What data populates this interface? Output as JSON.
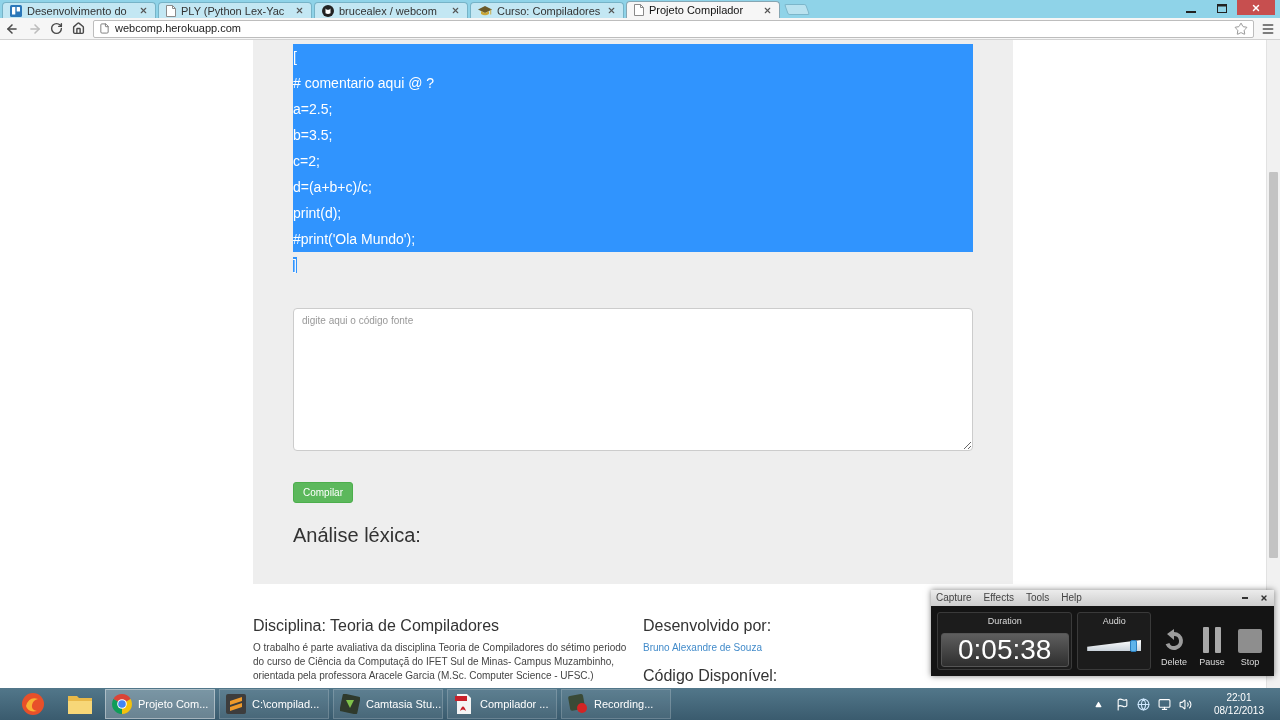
{
  "browser": {
    "tabs": [
      {
        "kind": "board",
        "title": "Desenvolvimento do",
        "selected": false
      },
      {
        "kind": "page",
        "title": "PLY (Python Lex-Yac",
        "selected": false
      },
      {
        "kind": "repo",
        "title": "brucealex / webcom",
        "selected": false
      },
      {
        "kind": "course",
        "title": "Curso: Compiladores",
        "selected": false
      },
      {
        "kind": "page",
        "title": "Projeto Compilador",
        "selected": true
      }
    ],
    "nav": {
      "back_disabled": false,
      "forward_disabled": true
    },
    "address": "webcomp.herokuapp.com"
  },
  "page": {
    "code_lines": [
      {
        "text": "[",
        "selected": true
      },
      {
        "text": "# comentario aqui @ ?",
        "selected": true
      },
      {
        "text": "a=2.5;",
        "selected": true
      },
      {
        "text": "b=3.5;",
        "selected": true
      },
      {
        "text": "c=2;",
        "selected": true
      },
      {
        "text": "d=(a+b+c)/c;",
        "selected": true
      },
      {
        "text": "print(d);",
        "selected": true
      },
      {
        "text": "#print('Ola Mundo');",
        "selected": true
      },
      {
        "text": "]",
        "selected": true
      }
    ],
    "source_field": {
      "placeholder": "digite aqui o código fonte"
    },
    "compile_button": "Compilar",
    "result_heading": "Análise léxica:",
    "footer": {
      "about": {
        "heading": "Disciplina: Teoria de Compiladores",
        "text": "O trabalho é parte avaliativa da disciplina Teoria de Compiladores do sétimo periodo do curso de Ciência da Computaçã do IFET Sul de Minas- Campus Muzambinho, orientada pela professora Aracele Garcia (M.Sc. Computer Science - UFSC.)"
      },
      "author": {
        "heading": "Desenvolvido por:",
        "link": "Bruno Alexandre de Souza"
      },
      "code_heading": "Código Disponível:"
    }
  },
  "recorder": {
    "menu": [
      "Capture",
      "Effects",
      "Tools",
      "Help"
    ],
    "duration": {
      "label": "Duration",
      "value": "0:05:38"
    },
    "audio": {
      "label": "Audio",
      "level": 0.92
    },
    "buttons": [
      {
        "kind": "delete",
        "label": "Delete"
      },
      {
        "kind": "pause",
        "label": "Pause"
      },
      {
        "kind": "stop",
        "label": "Stop"
      }
    ]
  },
  "taskbar": {
    "windows": [
      {
        "kind": "browser",
        "label": "Projeto Com...",
        "selected": true
      },
      {
        "kind": "editor",
        "label": "C:\\compilad...",
        "selected": false
      },
      {
        "kind": "studio",
        "label": "Camtasia Stu...",
        "selected": false
      },
      {
        "kind": "pdf",
        "label": "Compilador ...",
        "selected": false
      },
      {
        "kind": "recorder",
        "label": "Recording...",
        "selected": false
      }
    ],
    "clock": {
      "time": "22:01",
      "date": "08/12/2013"
    }
  }
}
